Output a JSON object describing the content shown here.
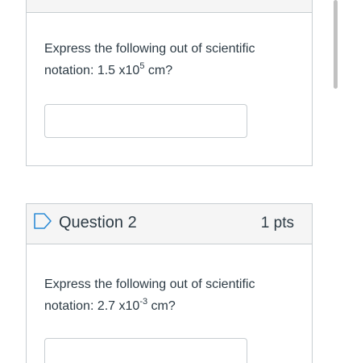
{
  "questions": [
    {
      "title": "",
      "points": "",
      "text_prefix": "Express the following out of scientific notation:  1.5 x10",
      "exponent": "5",
      "text_suffix": " cm?",
      "answer_value": ""
    },
    {
      "title": "Question 2",
      "points": "1 pts",
      "text_prefix": "Express the following out of scientific notation:  2.7 x10",
      "exponent": "-3",
      "text_suffix": " cm?",
      "answer_value": ""
    }
  ],
  "icons": {
    "flag": "bookmark-flag-icon"
  },
  "colors": {
    "border": "#c7cdd1",
    "header_bg": "#f5f5f5",
    "text": "#2d3b45",
    "flag": "#2d8bd6"
  }
}
